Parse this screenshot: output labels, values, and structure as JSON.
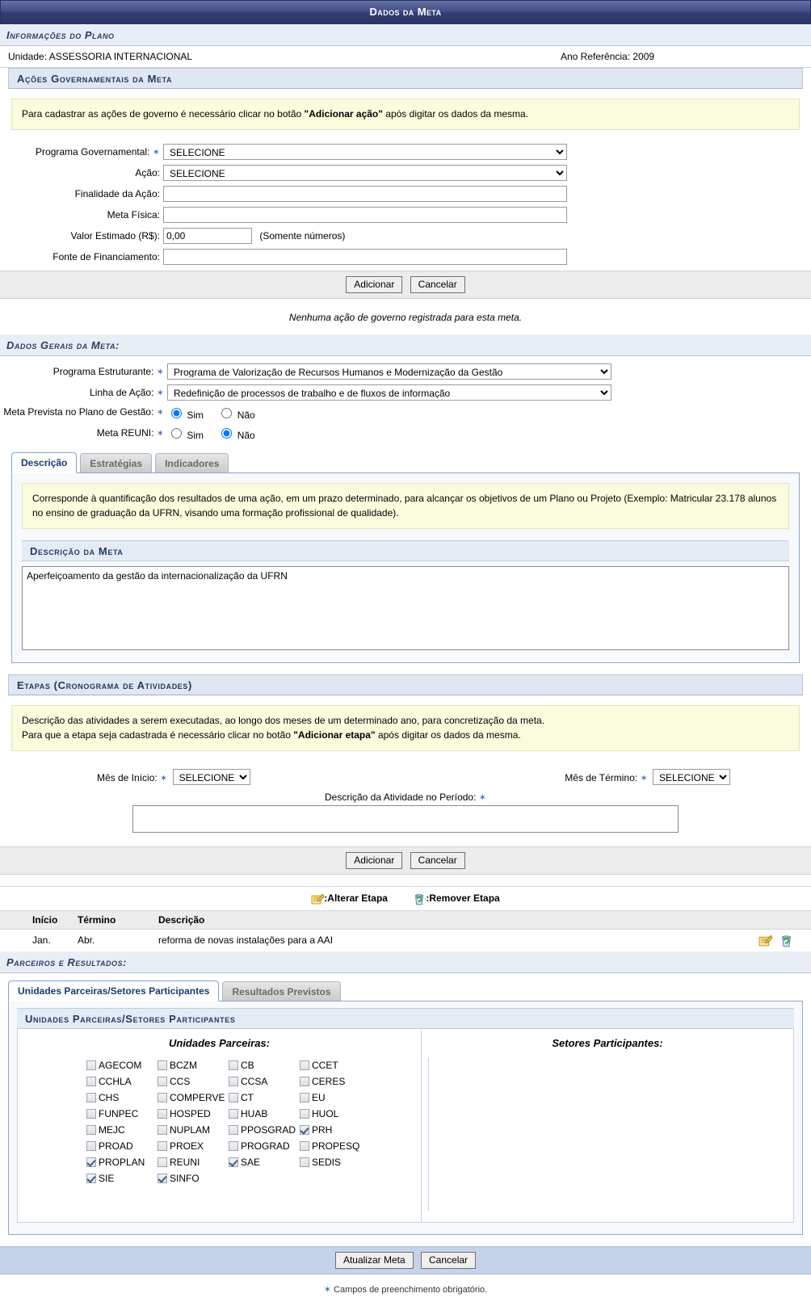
{
  "window": {
    "title": "Dados da Meta"
  },
  "plano": {
    "section_title": "Informações do Plano",
    "unidade_label": "Unidade: ASSESSORIA INTERNACIONAL",
    "ano_label": "Ano Referência: 2009"
  },
  "acoes": {
    "section_title": "Ações Governamentais da Meta",
    "hint_prefix": "Para cadastrar as ações de governo é necessário clicar no botão ",
    "hint_bold": "\"Adicionar ação\"",
    "hint_suffix": " após digitar os dados da mesma.",
    "fields": {
      "programa_label": "Programa Governamental:",
      "programa_value": "SELECIONE",
      "acao_label": "Ação:",
      "acao_value": "SELECIONE",
      "finalidade_label": "Finalidade da Ação:",
      "finalidade_value": "",
      "meta_fisica_label": "Meta Física:",
      "meta_fisica_value": "",
      "valor_label": "Valor Estimado (R$):",
      "valor_value": "0,00",
      "valor_hint": "(Somente números)",
      "fonte_label": "Fonte de Financiamento:",
      "fonte_value": ""
    },
    "add_button": "Adicionar",
    "cancel_button": "Cancelar",
    "empty_message": "Nenhuma ação de governo registrada para esta meta."
  },
  "gerais": {
    "section_title": "Dados Gerais da Meta:",
    "programa_estruturante_label": "Programa Estruturante:",
    "programa_estruturante_value": "Programa de Valorização de Recursos Humanos e Modernização da Gestão",
    "linha_acao_label": "Linha de Ação:",
    "linha_acao_value": "Redefinição de processos de trabalho e de fluxos de informação",
    "meta_prevista_label": "Meta Prevista no Plano de Gestão:",
    "meta_prevista_sim": "Sim",
    "meta_prevista_nao": "Não",
    "meta_prevista_selected": "Sim",
    "meta_reuni_label": "Meta REUNI:",
    "meta_reuni_sim": "Sim",
    "meta_reuni_nao": "Não",
    "meta_reuni_selected": "Não"
  },
  "meta_tabs": {
    "items": [
      {
        "label": "Descrição",
        "active": true
      },
      {
        "label": "Estratégias",
        "active": false
      },
      {
        "label": "Indicadores",
        "active": false
      }
    ],
    "hint": "Corresponde à quantificação dos resultados de uma ação, em um prazo determinado, para alcançar os objetivos de um Plano ou Projeto (Exemplo: Matricular 23.178 alunos no ensino de graduação da UFRN, visando uma formação profissional de qualidade).",
    "desc_header": "Descrição da Meta",
    "desc_value": "Aperfeiçoamento da gestão da internacionalização da UFRN"
  },
  "etapas": {
    "section_title": "Etapas (Cronograma de Atividades)",
    "hint_line1": "Descrição das atividades a serem executadas, ao longo dos meses de um determinado ano, para concretização da meta.",
    "hint_line2_prefix": "Para que a etapa seja cadastrada é necessário clicar no botão ",
    "hint_line2_bold": "\"Adicionar etapa\"",
    "hint_line2_suffix": " após digitar os dados da mesma.",
    "mes_inicio_label": "Mês de Início:",
    "mes_inicio_value": "SELECIONE",
    "mes_termino_label": "Mês de Término:",
    "mes_termino_value": "SELECIONE",
    "descricao_atividade_label": "Descrição da Atividade no Período:",
    "descricao_atividade_value": "",
    "add_button": "Adicionar",
    "cancel_button": "Cancelar",
    "legend_alterar": ":Alterar Etapa",
    "legend_remover": ":Remover Etapa",
    "columns": [
      "Início",
      "Término",
      "Descrição"
    ],
    "rows": [
      {
        "inicio": "Jan.",
        "termino": "Abr.",
        "descricao": "reforma de novas instalações para a AAI"
      }
    ]
  },
  "parceiros": {
    "section_title": "Parceiros e Resultados:",
    "tabs": [
      {
        "label": "Unidades Parceiras/Setores Participantes",
        "active": true
      },
      {
        "label": "Resultados Previstos",
        "active": false
      }
    ],
    "panel_title": "Unidades Parceiras/Setores Participantes",
    "unidades_title": "Unidades Parceiras:",
    "setores_title": "Setores Participantes:",
    "unidades": [
      [
        {
          "label": "AGECOM",
          "checked": false
        },
        {
          "label": "BCZM",
          "checked": false
        },
        {
          "label": "CB",
          "checked": false
        },
        {
          "label": "CCET",
          "checked": false
        }
      ],
      [
        {
          "label": "CCHLA",
          "checked": false
        },
        {
          "label": "CCS",
          "checked": false
        },
        {
          "label": "CCSA",
          "checked": false
        },
        {
          "label": "CERES",
          "checked": false
        }
      ],
      [
        {
          "label": "CHS",
          "checked": false
        },
        {
          "label": "COMPERVE",
          "checked": false
        },
        {
          "label": "CT",
          "checked": false
        },
        {
          "label": "EU",
          "checked": false
        }
      ],
      [
        {
          "label": "FUNPEC",
          "checked": false
        },
        {
          "label": "HOSPED",
          "checked": false
        },
        {
          "label": "HUAB",
          "checked": false
        },
        {
          "label": "HUOL",
          "checked": false
        }
      ],
      [
        {
          "label": "MEJC",
          "checked": false
        },
        {
          "label": "NUPLAM",
          "checked": false
        },
        {
          "label": "PPOSGRAD",
          "checked": false
        },
        {
          "label": "PRH",
          "checked": true
        }
      ],
      [
        {
          "label": "PROAD",
          "checked": false
        },
        {
          "label": "PROEX",
          "checked": false
        },
        {
          "label": "PROGRAD",
          "checked": false
        },
        {
          "label": "PROPESQ",
          "checked": false
        }
      ],
      [
        {
          "label": "PROPLAN",
          "checked": true
        },
        {
          "label": "REUNI",
          "checked": false
        },
        {
          "label": "SAE",
          "checked": true
        },
        {
          "label": "SEDIS",
          "checked": false
        }
      ],
      [
        {
          "label": "SIE",
          "checked": true
        },
        {
          "label": "SINFO",
          "checked": true
        },
        {
          "label": "",
          "checked": false
        },
        {
          "label": "",
          "checked": false
        }
      ]
    ],
    "setores": []
  },
  "footer": {
    "submit_button": "Atualizar Meta",
    "cancel_button": "Cancelar",
    "required_note": "Campos de preenchimento obrigatório."
  },
  "icons": {
    "edit": "edit-pencil-icon",
    "delete": "recycle-bin-icon",
    "required_star": "required-asterisk-icon"
  },
  "colors": {
    "titlebar": "#2c3566",
    "section_blue": "#27385f",
    "hint_yellow": "#fbfbdd",
    "accent": "#3b6fbe"
  }
}
